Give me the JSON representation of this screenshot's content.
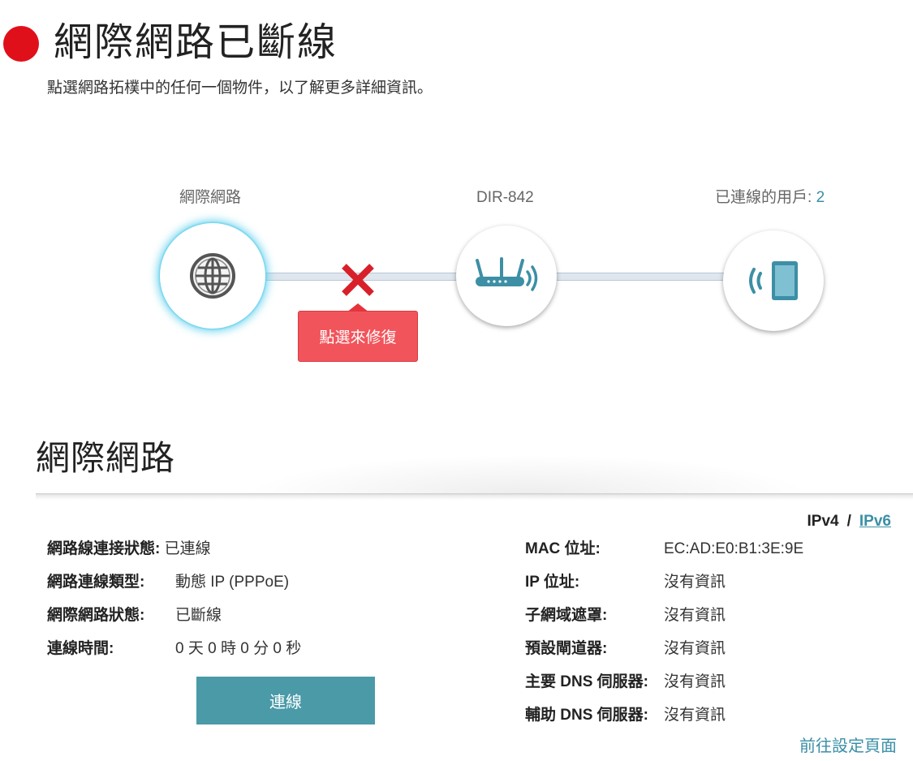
{
  "header": {
    "title": "網際網路已斷線",
    "subtitle": "點選網路拓樸中的任何一個物件，以了解更多詳細資訊。",
    "status_color": "#e0101a"
  },
  "topology": {
    "internet_label": "網際網路",
    "router_label": "DIR-842",
    "clients_label": "已連線的用戶:",
    "clients_count": "2",
    "fix_button_label": "點選來修復",
    "icons": [
      "globe-icon",
      "router-icon",
      "tablet-wifi-icon",
      "disconnect-x-icon"
    ]
  },
  "section": {
    "title": "網際網路",
    "ip_versions": {
      "ipv4": "IPv4",
      "separator": "/",
      "ipv6": "IPv6"
    }
  },
  "left_info": [
    {
      "label": "網路線連接狀態:",
      "value": "已連線"
    },
    {
      "label": "網路連線類型:",
      "value": "動態 IP (PPPoE)"
    },
    {
      "label": "網際網路狀態:",
      "value": "已斷線"
    },
    {
      "label": "連線時間:",
      "value": "0 天 0 時 0 分 0 秒"
    }
  ],
  "right_info": [
    {
      "label": "MAC 位址:",
      "value": "EC:AD:E0:B1:3E:9E"
    },
    {
      "label": "IP 位址:",
      "value": "沒有資訊"
    },
    {
      "label": "子網域遮罩:",
      "value": "沒有資訊"
    },
    {
      "label": "預設閘道器:",
      "value": "沒有資訊"
    },
    {
      "label": "主要 DNS 伺服器:",
      "value": "沒有資訊"
    },
    {
      "label": "輔助 DNS 伺服器:",
      "value": "沒有資訊"
    }
  ],
  "connect_button_label": "連線",
  "goto_settings_label": "前往設定頁面",
  "colors": {
    "accent": "#3a8fa6",
    "button": "#4a9aa8",
    "error": "#e8323b",
    "fix_button": "#f2545b"
  }
}
